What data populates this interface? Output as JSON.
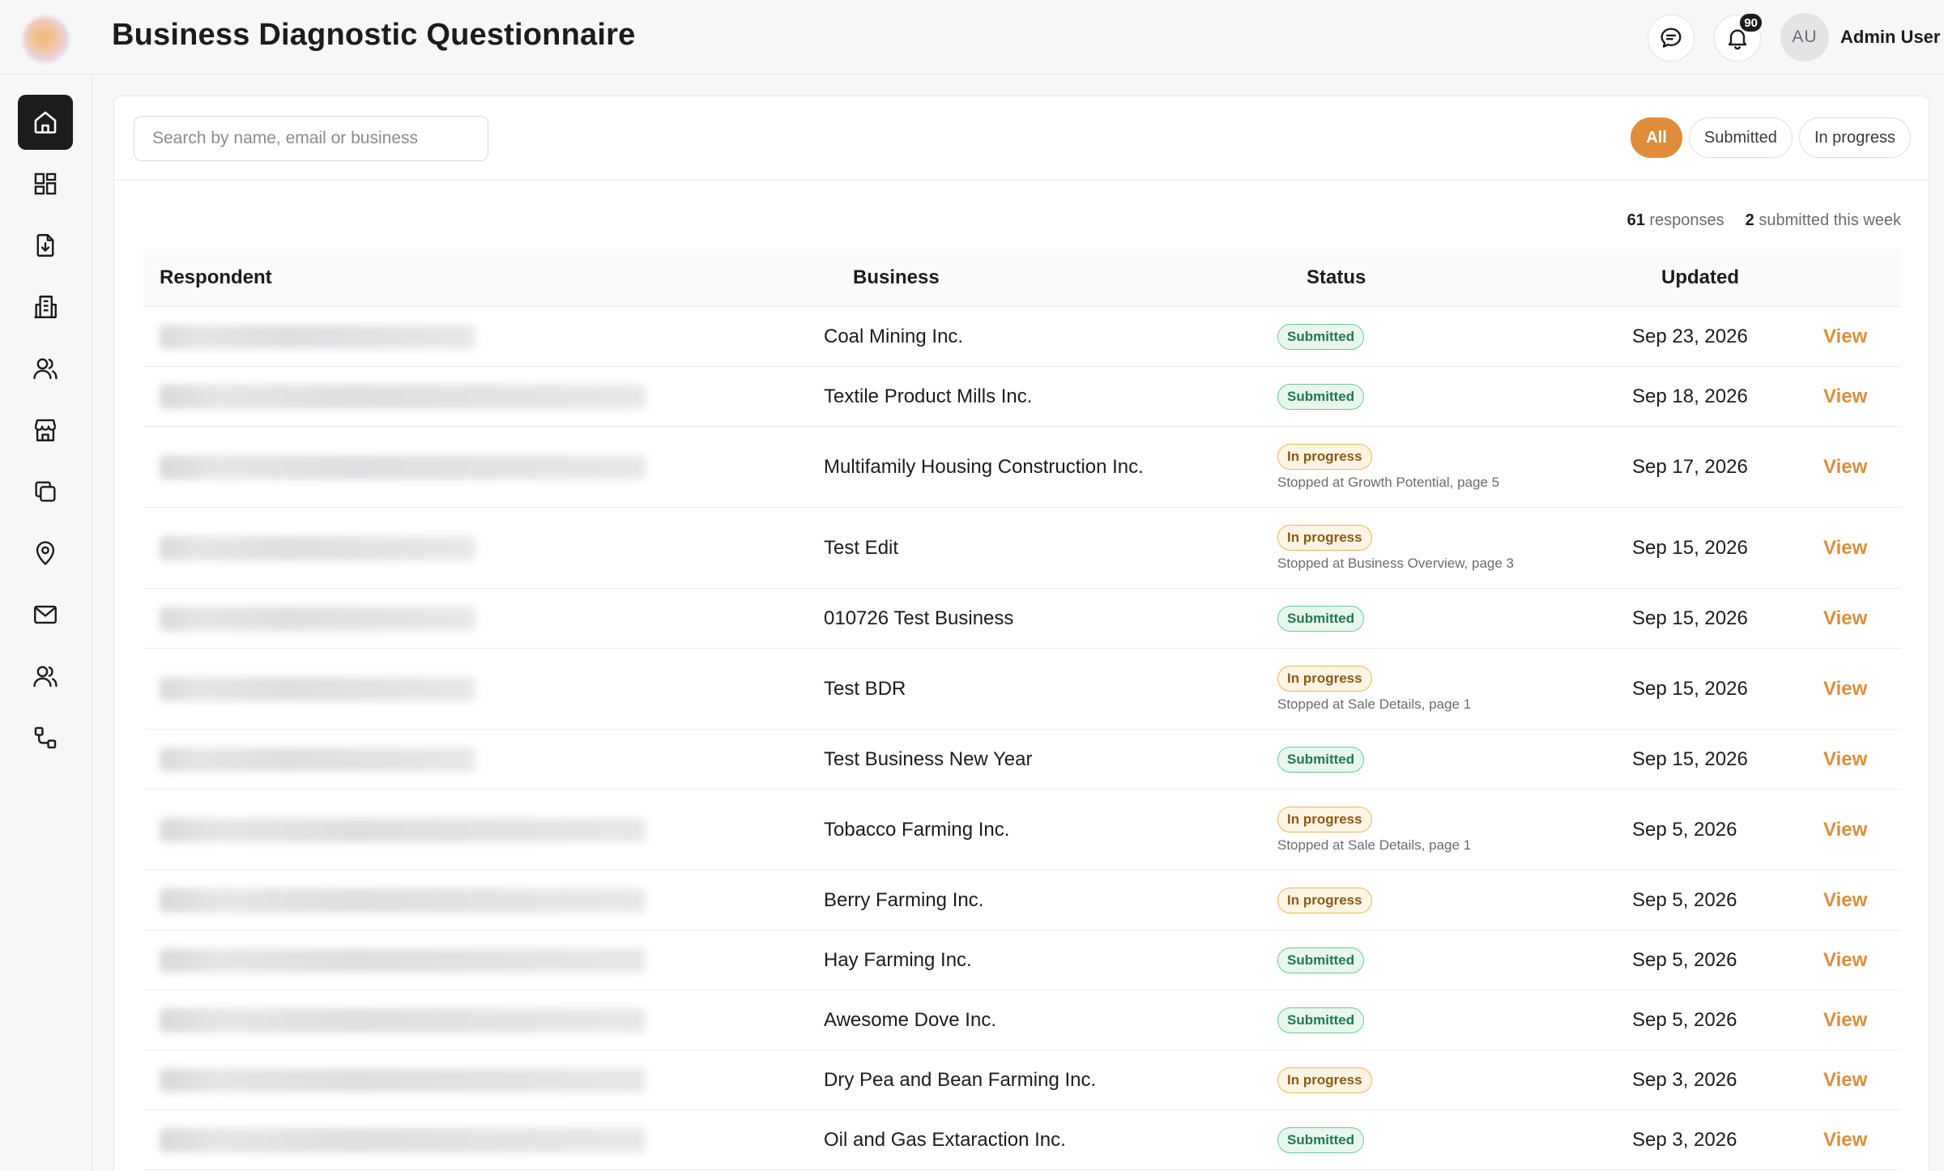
{
  "header": {
    "title": "Business Diagnostic Questionnaire",
    "notification_count": "90",
    "avatar_initials": "AU",
    "user_name": "Admin User"
  },
  "sidebar": {
    "items": [
      {
        "icon": "home-icon",
        "active": true
      },
      {
        "icon": "dashboard-icon",
        "active": false
      },
      {
        "icon": "file-download-icon",
        "active": false
      },
      {
        "icon": "building-icon",
        "active": false
      },
      {
        "icon": "users-icon",
        "active": false
      },
      {
        "icon": "store-icon",
        "active": false
      },
      {
        "icon": "copy-icon",
        "active": false
      },
      {
        "icon": "location-pin-icon",
        "active": false
      },
      {
        "icon": "mail-icon",
        "active": false
      },
      {
        "icon": "team-icon",
        "active": false
      },
      {
        "icon": "workflow-icon",
        "active": false
      }
    ]
  },
  "search": {
    "placeholder": "Search by name, email or business",
    "value": ""
  },
  "filters": {
    "all": "All",
    "submitted": "Submitted",
    "in_progress": "In progress",
    "active": "all"
  },
  "summary": {
    "responses_count": "61",
    "responses_label": "responses",
    "week_count": "2",
    "week_label": "submitted this week"
  },
  "table": {
    "columns": {
      "respondent": "Respondent",
      "business": "Business",
      "status": "Status",
      "updated": "Updated"
    },
    "view_label": "View",
    "rows": [
      {
        "business": "Coal Mining Inc.",
        "status": "Submitted",
        "status_type": "submitted",
        "note": "",
        "updated": "Sep 23, 2026"
      },
      {
        "business": "Textile Product Mills Inc.",
        "status": "Submitted",
        "status_type": "submitted",
        "note": "",
        "updated": "Sep 18, 2026"
      },
      {
        "business": "Multifamily Housing Construction Inc.",
        "status": "In progress",
        "status_type": "progress",
        "note": "Stopped at Growth Potential, page 5",
        "updated": "Sep 17, 2026"
      },
      {
        "business": "Test Edit",
        "status": "In progress",
        "status_type": "progress",
        "note": "Stopped at Business Overview, page 3",
        "updated": "Sep 15, 2026"
      },
      {
        "business": "010726 Test Business",
        "status": "Submitted",
        "status_type": "submitted",
        "note": "",
        "updated": "Sep 15, 2026"
      },
      {
        "business": "Test BDR",
        "status": "In progress",
        "status_type": "progress",
        "note": "Stopped at Sale Details, page 1",
        "updated": "Sep 15, 2026"
      },
      {
        "business": "Test Business New Year",
        "status": "Submitted",
        "status_type": "submitted",
        "note": "",
        "updated": "Sep 15, 2026"
      },
      {
        "business": "Tobacco Farming Inc.",
        "status": "In progress",
        "status_type": "progress",
        "note": "Stopped at Sale Details, page 1",
        "updated": "Sep 5, 2026"
      },
      {
        "business": "Berry Farming Inc.",
        "status": "In progress",
        "status_type": "progress",
        "note": "",
        "updated": "Sep 5, 2026"
      },
      {
        "business": "Hay Farming Inc.",
        "status": "Submitted",
        "status_type": "submitted",
        "note": "",
        "updated": "Sep 5, 2026"
      },
      {
        "business": "Awesome Dove Inc.",
        "status": "Submitted",
        "status_type": "submitted",
        "note": "",
        "updated": "Sep 5, 2026"
      },
      {
        "business": "Dry Pea and Bean Farming Inc.",
        "status": "In progress",
        "status_type": "progress",
        "note": "",
        "updated": "Sep 3, 2026"
      },
      {
        "business": "Oil and Gas Extaraction Inc.",
        "status": "Submitted",
        "status_type": "submitted",
        "note": "",
        "updated": "Sep 3, 2026"
      }
    ]
  },
  "colors": {
    "accent": "#de8d3c",
    "submitted_text": "#1f7a4c",
    "progress_text": "#8a5a12"
  }
}
